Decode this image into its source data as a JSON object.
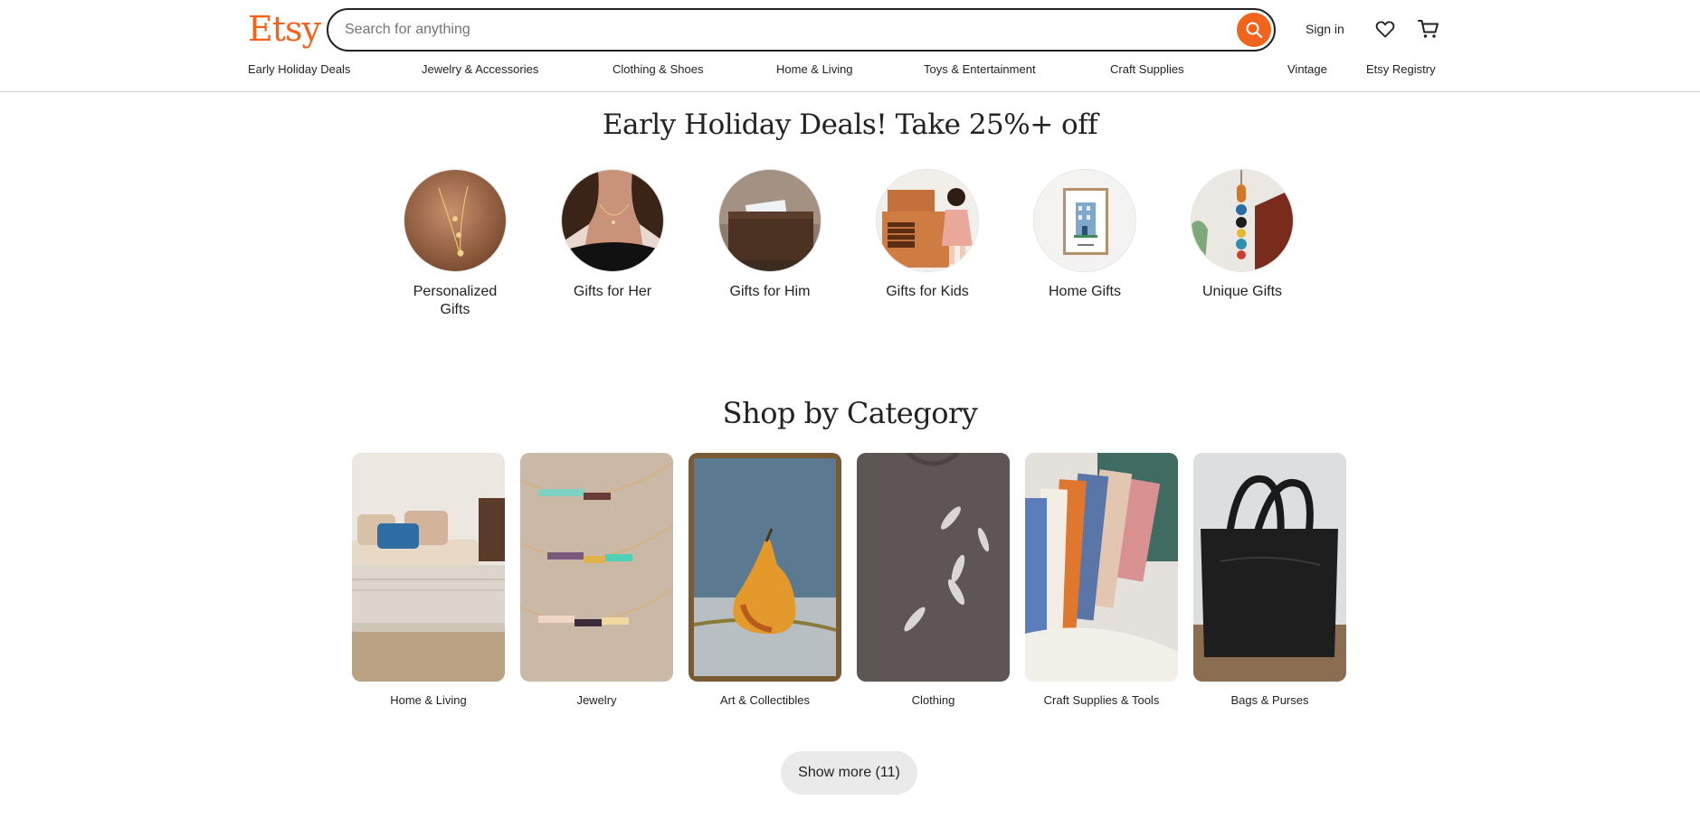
{
  "header": {
    "logo": "Etsy",
    "search": {
      "placeholder": "Search for anything",
      "value": ""
    },
    "sign_in": "Sign in",
    "icons": {
      "search": "search-icon",
      "favorites": "heart-icon",
      "cart": "cart-icon"
    },
    "accent_color": "#f1641e"
  },
  "nav": [
    "Early Holiday Deals",
    "Jewelry & Accessories",
    "Clothing & Shoes",
    "Home & Living",
    "Toys & Entertainment",
    "Craft Supplies",
    "Vintage",
    "Etsy Registry"
  ],
  "deals": {
    "title": "Early Holiday Deals! Take 25%+ off",
    "items": [
      {
        "label": "Personalized Gifts"
      },
      {
        "label": "Gifts for Her"
      },
      {
        "label": "Gifts for Him"
      },
      {
        "label": "Gifts for Kids"
      },
      {
        "label": "Home Gifts"
      },
      {
        "label": "Unique Gifts"
      }
    ]
  },
  "categories": {
    "title": "Shop by Category",
    "items": [
      {
        "label": "Home & Living"
      },
      {
        "label": "Jewelry"
      },
      {
        "label": "Art & Collectibles"
      },
      {
        "label": "Clothing"
      },
      {
        "label": "Craft Supplies & Tools"
      },
      {
        "label": "Bags & Purses"
      }
    ],
    "show_more": "Show more (11)"
  }
}
